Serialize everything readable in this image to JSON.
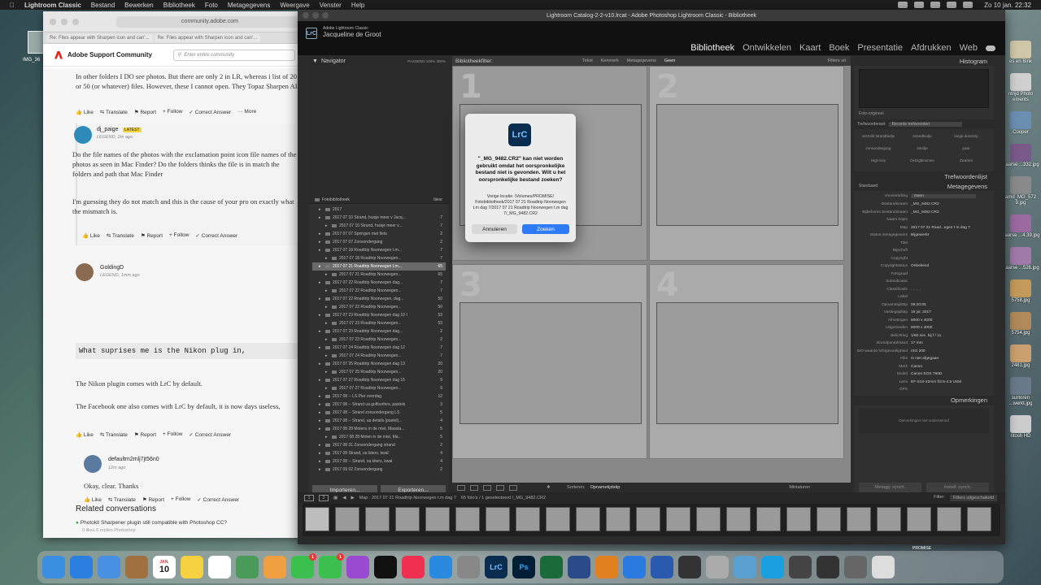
{
  "menubar": {
    "app": "Lightroom Classic",
    "items": [
      "Bestand",
      "Bewerken",
      "Bibliotheek",
      "Foto",
      "Metagegevens",
      "Weergave",
      "Venster",
      "Help"
    ],
    "clock": "Zo 10 jan.  22:32"
  },
  "desktop": {
    "left_label": "IMG_36",
    "right_icons": [
      "es en Bink",
      "ntrijd Photo ements",
      "Cooper",
      "Paarse ...332.jpg",
      "amd_MG_572 9.jpg",
      "Paarse ...4.39.jpg",
      "Paarse ...526.jpg",
      "5758.jpg",
      "5754.jpg",
      "2481.jpg",
      "surtoren ...werkt.jpg",
      "ntosh HD"
    ]
  },
  "browser": {
    "url": "community.adobe.com",
    "tabs": [
      "Re: Files appear with Sharpen icon and can'...",
      "Re: Files appear with Sharpen icon and can'..."
    ],
    "site_title": "Adobe Support Community",
    "search_placeholder": "Enter entire community",
    "post1": "In other folders I DO see photos. But there are only 2 in LR, whereas i list of 20 or 50 (or whatever) files. However, these I cannot open. They Topaz Sharpen AI.",
    "actions": {
      "like": "Like",
      "translate": "Translate",
      "report": "Report",
      "follow": "Follow",
      "correct": "Correct Answer",
      "more": "More"
    },
    "reply1": {
      "user": "dj_paige",
      "badge": "LATEST",
      "meta": "LEGEND, 2m ago",
      "p1": "Do the file names of the photos with the exclamation point icon file names of the photos as seen in Mac Finder? Do the folders thinks the file is in match the folders and path that Mac Finder",
      "p2": "I'm guessing they do not match and this is the cause of your pro on exactly what the mismatch is."
    },
    "reply2": {
      "user": "GoldingD",
      "meta": "LEGEND, 1mm ago"
    },
    "code": "What suprises me is the Nikon plug in,",
    "p3": "The Nikon plugin comes with LrC by default.",
    "p4": "The Facebook one also comes with LrC by default, it is now days useless,",
    "reply3": {
      "user": "defaultm2mlj7jt56n0",
      "meta": "12m ago",
      "text": "Okay, clear. Thanks"
    },
    "related": {
      "title": "Related conversations",
      "item": "Photokit Sharpener plugin still compatible with Photoshop CC?",
      "meta": "0 likes     6 replies     Photoshop"
    }
  },
  "lr": {
    "title": "Lightroom Catalog-2-2-v10.lrcat - Adobe Photoshop Lightroom Classic - Bibliotheek",
    "brand_small": "Adobe Lightroom Classic",
    "brand_name": "Jacqueline de Groot",
    "modules": [
      "Bibliotheek",
      "Ontwikkelen",
      "Kaart",
      "Boek",
      "Presentatie",
      "Afdrukken",
      "Web"
    ],
    "navigator": {
      "title": "Navigator",
      "zoom": "PASSEND   100%   300%"
    },
    "folders_root": {
      "name": "Fotobibliotheek",
      "size": "Itiesr"
    },
    "folders": [
      {
        "n": "2017",
        "c": ""
      },
      {
        "n": "2017 07 10 Strand, huisje meer v Jacq...",
        "c": "7"
      },
      {
        "n": "2017 07 10 Strand, huisje meer v...",
        "c": "7"
      },
      {
        "n": "2017 07 07 Springen met fiets",
        "c": "2"
      },
      {
        "n": "2017 07 07 Zonsondergang",
        "c": "2"
      },
      {
        "n": "2017 07 18 Roadtrip Noorwegen t.m...",
        "c": "7"
      },
      {
        "n": "2017 07 18 Roadtrip Noorwegen...",
        "c": "7"
      },
      {
        "n": "2017 07 21 Roadtrip Noorwegen t.m...",
        "c": "65"
      },
      {
        "n": "2017 07 21 Roadtrip Noorwegen...",
        "c": "65"
      },
      {
        "n": "2017 07 22 Roadtrip Noorwegen dag...",
        "c": "7"
      },
      {
        "n": "2017 07 22 Roadtrip Noorwegen...",
        "c": "7"
      },
      {
        "n": "2017 07 22 Roadtrip Noorwegen, dag...",
        "c": "50"
      },
      {
        "n": "2017 07 22 Roadtrip Noorwegen...",
        "c": "50"
      },
      {
        "n": "2017 07 23 Roadtrip Noorwegen dag 10 I",
        "c": "53"
      },
      {
        "n": "2017 07 23 Roadtrip Noorwegen...",
        "c": "53"
      },
      {
        "n": "2017 07 23 Roadtrip Noorwegen dag...",
        "c": "2"
      },
      {
        "n": "2017 07 23 Roadtrip Noorwegen...",
        "c": "2"
      },
      {
        "n": "2017 07 24 Roadtrip Noorwegen dag 12",
        "c": "7"
      },
      {
        "n": "2017 07 24 Roadtrip Noorwegen...",
        "c": "7"
      },
      {
        "n": "2017 07 25 Roadtrip Noorwegen dag 13",
        "c": "20"
      },
      {
        "n": "2017 07 25 Roadtrip Noorwegen...",
        "c": "20"
      },
      {
        "n": "2017 07 27 Roadtrip Noorwegen dag 15",
        "c": "9"
      },
      {
        "n": "2017 07 27 Roadtrip Noorwegen...",
        "c": "9"
      },
      {
        "n": "2017 08 -- LS Pier overdag",
        "c": "12"
      },
      {
        "n": "2017 08 -- Strand ua golfsurfers, pastels",
        "c": "3"
      },
      {
        "n": "2017 08 -- Strand zonsondergang LS",
        "c": "5"
      },
      {
        "n": "2017 08 -- Strand, ua details (pastel)...",
        "c": "4"
      },
      {
        "n": "2017 08 28 Molens in de mist, Maasla...",
        "c": "5"
      },
      {
        "n": "2017 08 28 Molen in de mist, Ma...",
        "c": "5"
      },
      {
        "n": "2017 08 31 Zonsondergang strand",
        "c": "2"
      },
      {
        "n": "2017 08 Strand, oa kiters, kwal",
        "c": "4"
      },
      {
        "n": "2017 08 -- Strand, oa kiters, kwal",
        "c": "4"
      },
      {
        "n": "2017 09 02 Zonsondergang",
        "c": "2"
      }
    ],
    "selected_folder_index": 7,
    "import_btn": "Importeren...",
    "export_btn": "Exporteren...",
    "filterbar": {
      "title": "Bibliotheekfilter:",
      "items": [
        "Tekst",
        "Kenmerk",
        "Metagegevens",
        "Geen"
      ],
      "active": "Geen",
      "right": "Filters uit"
    },
    "grid_numbers": [
      "1",
      "2",
      "3",
      "4"
    ],
    "toolbar": {
      "sort_label": "Sorteren:",
      "sort_value": "Opnametijdstip",
      "thumb_label": "Miniaturen"
    },
    "right": {
      "histogram": "Histogram",
      "original_photo": "Foto-origineel",
      "keywords_label": "Trefwoordenset",
      "keywords_set": "Recente trefwoorden",
      "keywords": [
        "verzeild strandbedje",
        "strandbedje",
        "lange duinstrip",
        "zonsondergang",
        "streifje",
        "paar",
        "High Key",
        "Ostzigbloemen",
        "Zwarten"
      ],
      "kwlist": "Trefwoordenlijst",
      "metadata": "Metagegevens",
      "preset": "Standaard",
      "preset_label": "Voorinstelling",
      "preset_value": "Geen",
      "meta": [
        [
          "Bestandsnaam",
          "_MG_9482.CR2"
        ],
        [
          "Bijbehoren bestandsnaam",
          "_MG_9482.CR2"
        ],
        [
          "Naam kopie",
          ""
        ],
        [
          "Map",
          "2017 07 21 Road...egen t m dag 7"
        ],
        [
          "Status metagegevens",
          "Bijgewerkt"
        ],
        [
          "Titel",
          ""
        ],
        [
          "Bijschrift",
          ""
        ],
        [
          "Copyright",
          ""
        ],
        [
          "Copyrightstatus",
          "Onbekend"
        ],
        [
          "Fotograaf",
          ""
        ],
        [
          "Subsubcator",
          ""
        ],
        [
          "Classificatie",
          ". . . . ."
        ],
        [
          "Label",
          ""
        ],
        [
          "Opnametijdstip",
          "09:20:05"
        ],
        [
          "Vastlegtijdstip",
          "19 jul. 2017"
        ],
        [
          "Afmetingen",
          "6000 x 4000"
        ],
        [
          "Uitgesneden",
          "6000 x 4000"
        ],
        [
          "Belichting",
          "1/60 sec. bij f / 11"
        ],
        [
          "Brandpuntafstand",
          "17 mm"
        ],
        [
          "ISO-waarde lichtgevoeligheid",
          "ISO 200"
        ],
        [
          "Flits",
          "Is niet afgegaan"
        ],
        [
          "Merk",
          "Canon"
        ],
        [
          "Model",
          "Canon EOS 760D"
        ],
        [
          "Lens",
          "EF-S10-22mm f/3.5-4.5 USM"
        ],
        [
          "GPS",
          ""
        ]
      ],
      "comments": "Opmerkingen",
      "comments_placeholder": "Opmerkingen niet ondersteund",
      "sync_meta": "Metagg. synch.",
      "sync_set": "Instell. synch."
    },
    "filmstrip": {
      "pages": [
        "1",
        "2"
      ],
      "path": "Map : 2017 07 21 Roadtrip Noorwegen t.m dag 7",
      "count": "65 foto's / 1 geselecteerd /_MG_9482.CR2",
      "filter_label": "Filter:",
      "filter_value": "Filters uitgeschakeld",
      "thumb_count": 23
    }
  },
  "dialog": {
    "icon": "LrC",
    "message": "\"_MG_9482.CR2\" kan niet worden gebruikt omdat het oorspronkelijke bestand niet is gevonden. Wilt u het oorspronkelijke bestand zoeken?",
    "detail": "Vorige locatie: /Volumes/PROMISE/ Fotobibliotheek/2017 07 21 Roadtrip Noorwegen t.m dag 7/2017 07 21 Roadtrip Noorwegen t.m dag 7/_MG_9482.CR2",
    "cancel": "Annuleren",
    "confirm": "Zoeken"
  },
  "dock": {
    "apps": [
      "finder-icon",
      "safari-icon",
      "mail-icon",
      "ssh-icon",
      "calendar-icon",
      "notes-icon",
      "reminders-icon",
      "maps-icon",
      "photos-icon",
      "messages-icon",
      "facetime-icon",
      "podcasts-icon",
      "tv-icon",
      "music-icon",
      "appstore-icon",
      "settings-icon",
      "lrc-icon",
      "ps-icon",
      "dxo-icon",
      "silverfast-icon",
      "ghostery-icon",
      "teamviewer-icon",
      "word-icon",
      "epson-icon",
      "prefs-icon",
      "colorsync-icon",
      "skype-icon",
      "calculator-icon",
      "printer-icon",
      "scanner-icon",
      "trash-icon"
    ],
    "calendar_month": "JAN.",
    "calendar_day": "10",
    "messages_badge": "1",
    "facetime_badge": "1",
    "lrc_label": "LrC",
    "ps_label": "Ps",
    "promise": "PROMISE",
    "macintosh": "Macintosh HD"
  }
}
